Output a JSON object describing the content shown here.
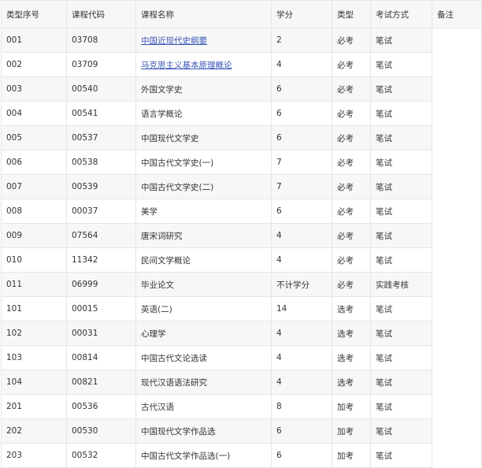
{
  "table": {
    "headers": [
      "类型序号",
      "课程代码",
      "课程名称",
      "学分",
      "类型",
      "考试方式",
      "备注"
    ],
    "rows": [
      {
        "seq": "001",
        "code": "03708",
        "name": "中国近现代史纲要",
        "credit": "2",
        "type": "必考",
        "exam": "笔试",
        "link": true
      },
      {
        "seq": "002",
        "code": "03709",
        "name": "马克思主义基本原理概论",
        "credit": "4",
        "type": "必考",
        "exam": "笔试",
        "link": true
      },
      {
        "seq": "003",
        "code": "00540",
        "name": "外国文学史",
        "credit": "6",
        "type": "必考",
        "exam": "笔试",
        "link": false
      },
      {
        "seq": "004",
        "code": "00541",
        "name": "语言学概论",
        "credit": "6",
        "type": "必考",
        "exam": "笔试",
        "link": false
      },
      {
        "seq": "005",
        "code": "00537",
        "name": "中国现代文学史",
        "credit": "6",
        "type": "必考",
        "exam": "笔试",
        "link": false
      },
      {
        "seq": "006",
        "code": "00538",
        "name": "中国古代文学史(一)",
        "credit": "7",
        "type": "必考",
        "exam": "笔试",
        "link": false
      },
      {
        "seq": "007",
        "code": "00539",
        "name": "中国古代文学史(二)",
        "credit": "7",
        "type": "必考",
        "exam": "笔试",
        "link": false
      },
      {
        "seq": "008",
        "code": "00037",
        "name": "美学",
        "credit": "6",
        "type": "必考",
        "exam": "笔试",
        "link": false
      },
      {
        "seq": "009",
        "code": "07564",
        "name": "唐宋词研究",
        "credit": "4",
        "type": "必考",
        "exam": "笔试",
        "link": false
      },
      {
        "seq": "010",
        "code": "11342",
        "name": "民间文学概论",
        "credit": "4",
        "type": "必考",
        "exam": "笔试",
        "link": false
      },
      {
        "seq": "011",
        "code": "06999",
        "name": "毕业论文",
        "credit": "不计学分",
        "type": "必考",
        "exam": "实践考核",
        "link": false
      },
      {
        "seq": "101",
        "code": "00015",
        "name": "英语(二)",
        "credit": "14",
        "type": "选考",
        "exam": "笔试",
        "link": false
      },
      {
        "seq": "102",
        "code": "00031",
        "name": "心理学",
        "credit": "4",
        "type": "选考",
        "exam": "笔试",
        "link": false
      },
      {
        "seq": "103",
        "code": "00814",
        "name": "中国古代文论选读",
        "credit": "4",
        "type": "选考",
        "exam": "笔试",
        "link": false
      },
      {
        "seq": "104",
        "code": "00821",
        "name": "现代汉语语法研究",
        "credit": "4",
        "type": "选考",
        "exam": "笔试",
        "link": false
      },
      {
        "seq": "201",
        "code": "00536",
        "name": "古代汉语",
        "credit": "8",
        "type": "加考",
        "exam": "笔试",
        "link": false
      },
      {
        "seq": "202",
        "code": "00530",
        "name": "中国现代文学作品选",
        "credit": "6",
        "type": "加考",
        "exam": "笔试",
        "link": false
      },
      {
        "seq": "203",
        "code": "00532",
        "name": "中国古代文学作品选(一)",
        "credit": "6",
        "type": "加考",
        "exam": "笔试",
        "link": false
      }
    ]
  },
  "colors": {
    "link": "#3a56b8",
    "stripe": "#f7f7f7",
    "border": "#e6e6e6",
    "text": "#333333"
  }
}
